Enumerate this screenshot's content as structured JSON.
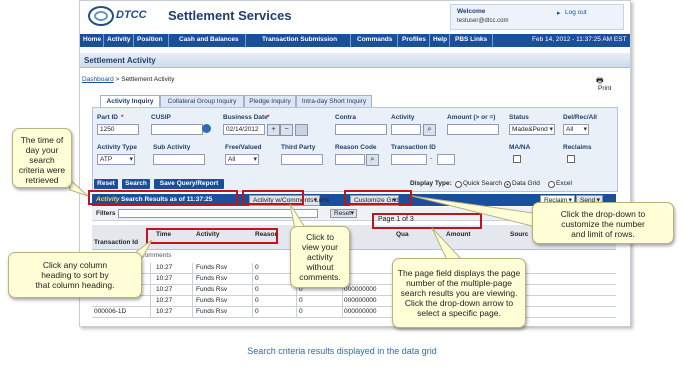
{
  "header": {
    "logo_text": "DTCC",
    "app_title": "Settlement Services",
    "welcome": "Welcome",
    "user_email": "testuser@dtcc.com",
    "logout": "Log out"
  },
  "nav": {
    "items": [
      "Home",
      "Activity",
      "Position",
      "Cash and Balances",
      "Transaction Submission",
      "Commands",
      "Profiles",
      "Help",
      "PBS Links"
    ],
    "datetime": "Feb 14, 2012 - 11:37:25 AM EST"
  },
  "page": {
    "section_title": "Settlement Activity",
    "breadcrumb_home": "Dashboard",
    "breadcrumb_sep": " > ",
    "breadcrumb_current": "Settlement Activity",
    "print": "Print"
  },
  "tabs": [
    "Activity Inquiry",
    "Collateral Group Inquiry",
    "Pledge Inquiry",
    "Intra-day Short Inquiry"
  ],
  "form": {
    "part_id": {
      "label": "Part ID",
      "value": "1250"
    },
    "cusip": {
      "label": "CUSIP",
      "value": ""
    },
    "business_date": {
      "label": "Business Date",
      "value": "02/14/2012"
    },
    "contra": {
      "label": "Contra",
      "value": ""
    },
    "activity": {
      "label": "Activity",
      "value": ""
    },
    "amount": {
      "label": "Amount (> or =)",
      "value": ""
    },
    "status": {
      "label": "Status",
      "value": "Made&Pend"
    },
    "del_rec_all": {
      "label": "Del/Rec/All",
      "value": "All"
    },
    "activity_type": {
      "label": "Activity Type",
      "value": "ATP"
    },
    "sub_activity": {
      "label": "Sub Activity",
      "value": ""
    },
    "free_valued": {
      "label": "Free/Valued",
      "value": "All"
    },
    "third_party": {
      "label": "Third Party",
      "value": ""
    },
    "reason_code": {
      "label": "Reason Code",
      "value": ""
    },
    "transaction_id": {
      "label": "Transaction ID",
      "value": "",
      "sep": "-"
    },
    "ma_na": {
      "label": "MA/NA"
    },
    "reclaims": {
      "label": "Reclaims"
    },
    "required_mark": "*",
    "plus": "+",
    "minus": "−"
  },
  "actions": {
    "reset": "Reset",
    "search": "Search",
    "save_query": "Save Query/Report",
    "display_type_label": "Display Type:",
    "display_options": [
      "Quick Search",
      "Data Grid",
      "Excel"
    ],
    "selected_display": "Data Grid"
  },
  "grid": {
    "title_a": "Activity",
    "title_b": "Search Results as of 11:37:25",
    "lens": "Activity w/Comments Lens",
    "customize": "Customize Grid",
    "reclaim": "Reclaim",
    "send": "Send",
    "filters": "Filters",
    "filter_reset": "Reset",
    "page_field": "Page 1 of 3",
    "columns": [
      "Transaction Id",
      "Time",
      "Activity",
      "Reason",
      "Qua",
      "Amount",
      "Sourc"
    ],
    "comments_label": "Comments",
    "rows": [
      {
        "id": "",
        "time": "10:27",
        "activity": "Funds Rsv",
        "reason": "0",
        "extra": "",
        "amount": ""
      },
      {
        "id": "",
        "time": "10:27",
        "activity": "Funds Rsv",
        "reason": "0",
        "extra": "",
        "amount": ""
      },
      {
        "id": "",
        "time": "10:27",
        "activity": "Funds Rsv",
        "reason": "0",
        "extra": "0",
        "amount": "000000000"
      },
      {
        "id": "",
        "time": "10:27",
        "activity": "Funds Rsv",
        "reason": "0",
        "extra": "0",
        "amount": "000000000"
      },
      {
        "id": "000006-1D",
        "time": "10:27",
        "activity": "Funds Rsv",
        "reason": "0",
        "extra": "0",
        "amount": "000000000"
      }
    ]
  },
  "callouts": {
    "time_of_day": [
      "The time of",
      "day your",
      "search",
      "criteria were",
      "retrieved"
    ],
    "column_heading": [
      "Click any column",
      "heading to sort by",
      "that column heading."
    ],
    "lens": [
      "Click to",
      "view your",
      "activity",
      "without",
      "comments."
    ],
    "page_field": [
      "The page field displays the page",
      "number of the multiple-page",
      "search results you are viewing.",
      "Click the drop-down arrow to",
      "select a specific page."
    ],
    "customize": [
      "Click the drop-down to",
      "customize the number",
      "and limit of rows."
    ]
  },
  "caption": "Search criteria results displayed in the data grid",
  "colors": {
    "nav_blue": "#1a4f9c",
    "callout_fill": "#fffed6",
    "highlight_red": "#c0141c",
    "caption_blue": "#2d6cb4"
  }
}
